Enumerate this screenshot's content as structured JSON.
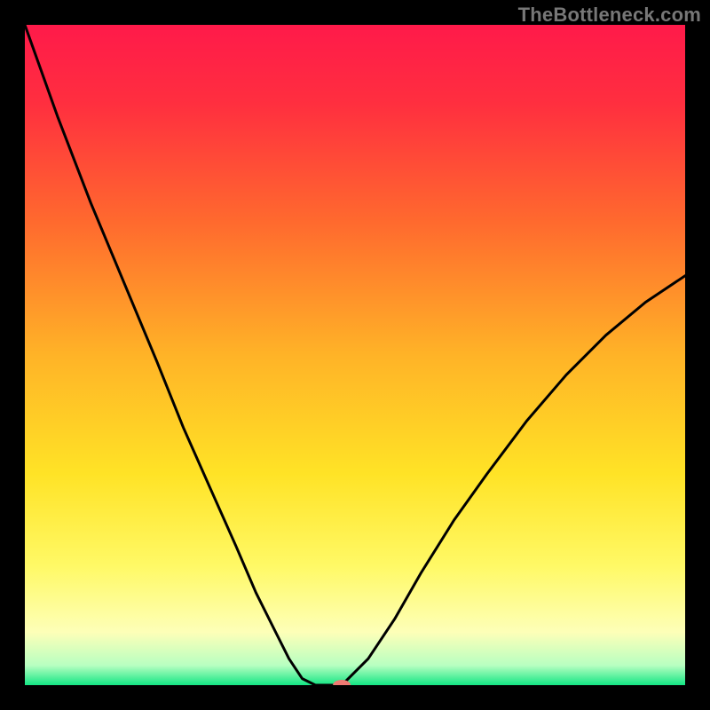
{
  "watermark": "TheBottleneck.com",
  "chart_data": {
    "type": "line",
    "title": "",
    "xlabel": "",
    "ylabel": "",
    "xlim": [
      0,
      100
    ],
    "ylim": [
      0,
      100
    ],
    "grid": false,
    "background_gradient_stops": [
      {
        "offset": 0.0,
        "color": "#ff1a4a"
      },
      {
        "offset": 0.12,
        "color": "#ff2f3f"
      },
      {
        "offset": 0.3,
        "color": "#ff6a2e"
      },
      {
        "offset": 0.5,
        "color": "#ffb327"
      },
      {
        "offset": 0.68,
        "color": "#ffe326"
      },
      {
        "offset": 0.82,
        "color": "#fff966"
      },
      {
        "offset": 0.92,
        "color": "#fdffb8"
      },
      {
        "offset": 0.97,
        "color": "#b8ffc1"
      },
      {
        "offset": 1.0,
        "color": "#13e684"
      }
    ],
    "series": [
      {
        "name": "left-branch",
        "color": "#000000",
        "x": [
          0,
          5,
          10,
          15,
          20,
          24,
          28,
          32,
          35,
          38,
          40,
          42,
          44
        ],
        "y": [
          100,
          86,
          73,
          61,
          49,
          39,
          30,
          21,
          14,
          8,
          4,
          1,
          0
        ]
      },
      {
        "name": "valley-floor",
        "color": "#000000",
        "x": [
          44,
          48
        ],
        "y": [
          0,
          0
        ]
      },
      {
        "name": "right-branch",
        "color": "#000000",
        "x": [
          48,
          52,
          56,
          60,
          65,
          70,
          76,
          82,
          88,
          94,
          100
        ],
        "y": [
          0,
          4,
          10,
          17,
          25,
          32,
          40,
          47,
          53,
          58,
          62
        ]
      }
    ],
    "marker": {
      "name": "bottleneck-point",
      "x": 48,
      "y": 0,
      "color": "#ef7a73",
      "rx": 10,
      "ry": 6
    }
  }
}
